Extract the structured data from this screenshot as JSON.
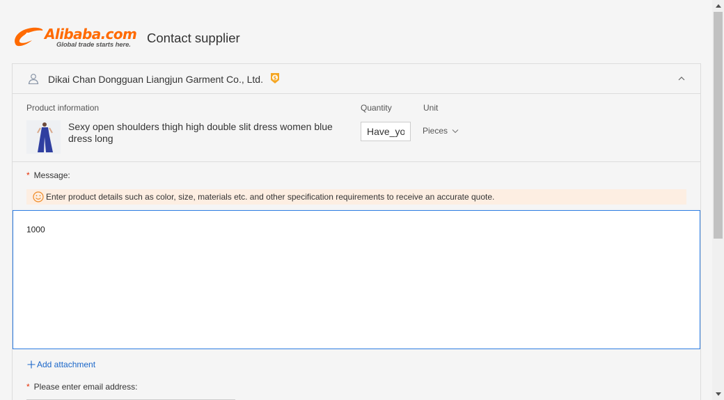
{
  "header": {
    "logo_text": "Alibaba.com",
    "logo_tagline": "Global trade starts here.",
    "title": "Contact supplier"
  },
  "supplier": {
    "name": "Dikai Chan Dongguan Liangjun Garment Co., Ltd.",
    "badge_icon": "gold-supplier-icon"
  },
  "product": {
    "section_label": "Product information",
    "quantity_label": "Quantity",
    "unit_label": "Unit",
    "name": "Sexy open shoulders thigh high double slit dress women blue dress long",
    "quantity_value": "Have_yo",
    "unit_value": "Pieces"
  },
  "message": {
    "required_mark": "*",
    "label": "Message:",
    "hint": "Enter product details such as color, size, materials etc. and other specification requirements to receive an accurate quote.",
    "value": "1000"
  },
  "attachment": {
    "label": "Add attachment"
  },
  "email": {
    "required_mark": "*",
    "label": "Please enter email address:"
  },
  "colors": {
    "brand": "#ff6a00",
    "link": "#1a66c9",
    "focus_border": "#2b7be2",
    "hint_bg": "#fdeee2",
    "required": "#e62e04"
  }
}
